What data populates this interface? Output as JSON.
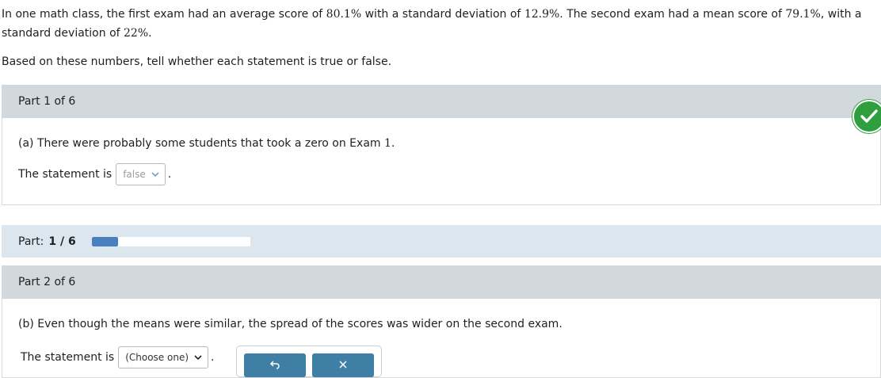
{
  "intro": {
    "p1": "In one math class, the first exam had an average score of ",
    "mean1": "80.1%",
    "p2": " with a standard deviation of ",
    "sd1": "12.9%",
    "p3": ". The second exam had a mean score of ",
    "mean2": "79.1%",
    "p4": ", with a standard deviation of ",
    "sd2": "22%",
    "p5": "."
  },
  "instruction": "Based on these numbers, tell whether each statement is true or false.",
  "part1": {
    "header": "Part 1 of 6",
    "question_text": "(a) There were probably some students that took a zero on Exam ",
    "question_num": "1.",
    "statement_label": "The statement is",
    "selected_value": "false",
    "period": ".",
    "status_icon": "check-circle-icon"
  },
  "progress": {
    "label": "Part:",
    "current": "1 / 6",
    "fraction": 0.1667
  },
  "part2": {
    "header": "Part 2 of 6",
    "question_text": "(b) Even though the means were similar, the spread of the scores was wider on the second exam.",
    "statement_label": "The statement is",
    "selected_value": "(Choose one)",
    "period": "."
  },
  "toolbar": {
    "undo_icon": "undo-icon",
    "clear_icon": "clear-x-icon"
  },
  "colors": {
    "header_bg": "#d2d9dc",
    "progress_bg": "#dbe6ef",
    "progress_fill": "#4a7fbf",
    "check_green": "#2e9e3e",
    "button_blue": "#3f7fa6"
  }
}
